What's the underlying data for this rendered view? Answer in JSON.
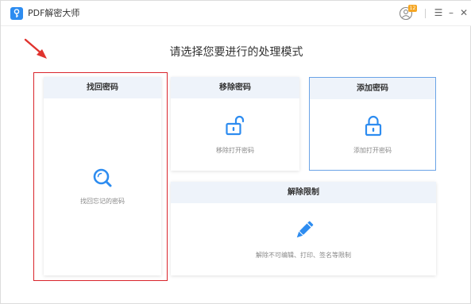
{
  "app": {
    "title": "PDF解密大师",
    "badge": "12"
  },
  "window_controls": {
    "menu": "☰",
    "minimize": "–",
    "close": "✕"
  },
  "heading": "请选择您要进行的处理模式",
  "cards": {
    "find": {
      "title": "找回密码",
      "caption": "找回忘记的密码",
      "icon": "search-icon"
    },
    "remove": {
      "title": "移除密码",
      "caption": "移除打开密码",
      "icon": "unlock-icon"
    },
    "add": {
      "title": "添加密码",
      "caption": "添加打开密码",
      "icon": "lock-icon"
    },
    "unlock": {
      "title": "解除限制",
      "caption": "解除不可编辑、打印、签名等限制",
      "icon": "pencil-icon"
    }
  },
  "colors": {
    "accent": "#2d8cf0",
    "card_header": "#eef3fa",
    "highlight": "#d9242b"
  }
}
